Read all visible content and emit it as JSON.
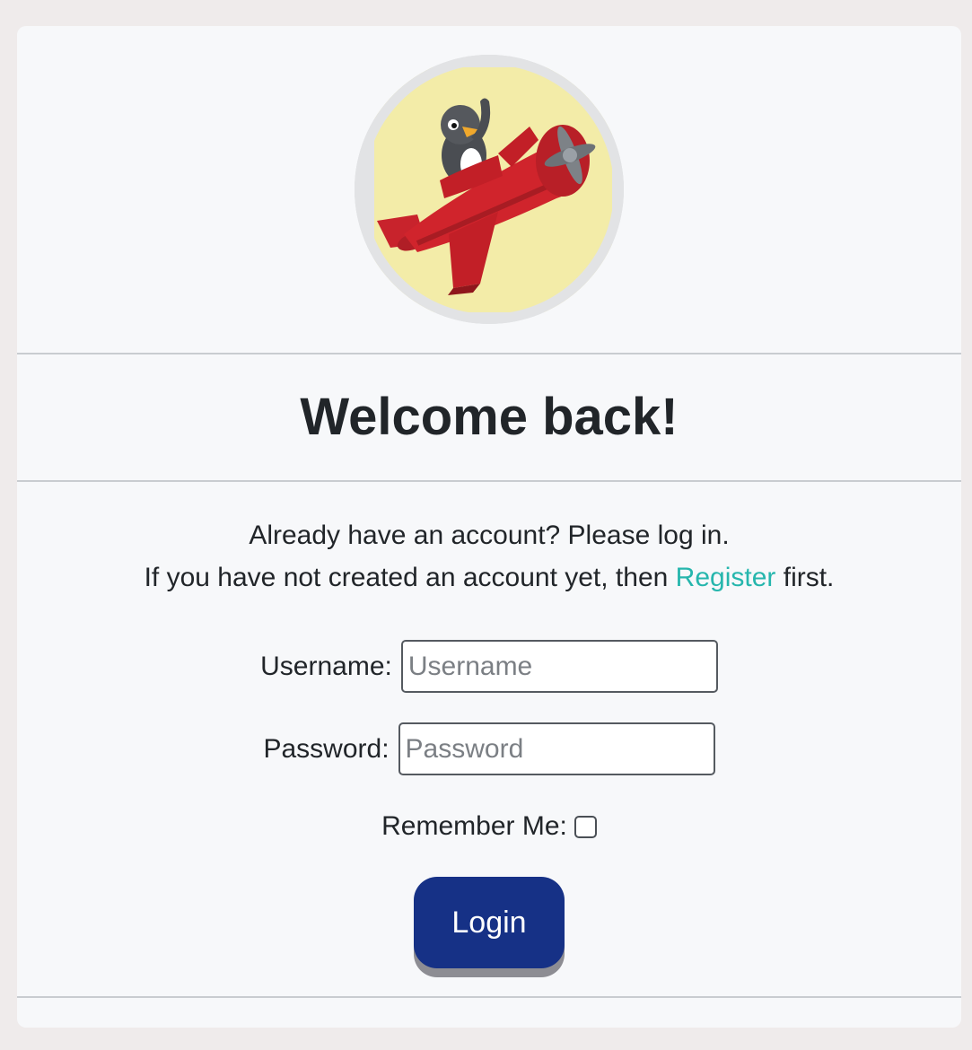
{
  "header": {
    "avatar_alt": "penguin-pilot-logo"
  },
  "main": {
    "title": "Welcome back!",
    "intro_line1": "Already have an account? Please log in.",
    "intro_line2_prefix": "If you have not created an account yet, then",
    "register_link": "Register",
    "intro_line2_suffix": "first."
  },
  "form": {
    "username_label": "Username:",
    "username_placeholder": "Username",
    "username_value": "",
    "password_label": "Password:",
    "password_placeholder": "Password",
    "password_value": "",
    "remember_label": "Remember Me:",
    "remember_checked": false,
    "login_label": "Login"
  },
  "colors": {
    "page_bg": "#efebeb",
    "card_bg": "#f7f8fa",
    "link": "#26b6ad",
    "login_button": "#163186",
    "login_shadow": "#8d8d93"
  }
}
